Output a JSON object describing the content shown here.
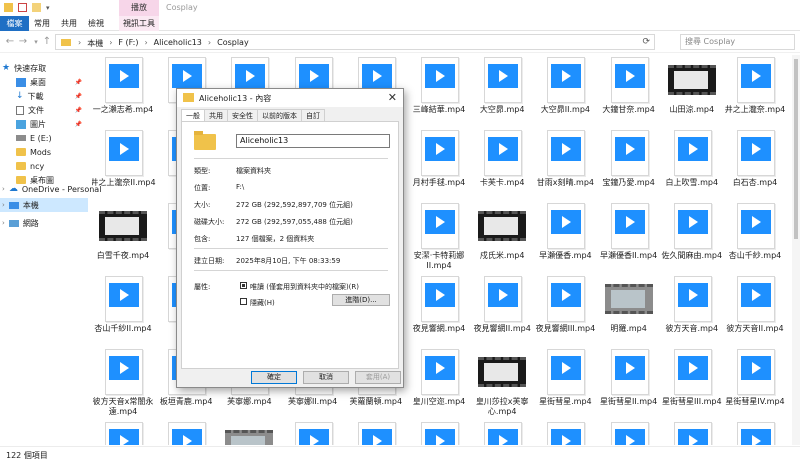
{
  "window": {
    "title": "Cosplay",
    "contextual_group": "播放"
  },
  "ribbon": {
    "file_tab": "檔案",
    "tabs": [
      "常用",
      "共用",
      "檢視",
      "視訊工具"
    ]
  },
  "nav": {
    "back": "←",
    "forward": "→",
    "up": "↑"
  },
  "address": {
    "crumbs": [
      "本機",
      "F (F:)",
      "Aliceholic13",
      "Cosplay"
    ]
  },
  "search": {
    "placeholder": "搜尋 Cosplay"
  },
  "sidebar": {
    "items": [
      {
        "label": "快速存取",
        "icon": "star-icon"
      },
      {
        "label": "桌面",
        "icon": "desktop-icon"
      },
      {
        "label": "下載",
        "icon": "download-icon"
      },
      {
        "label": "文件",
        "icon": "document-icon"
      },
      {
        "label": "圖片",
        "icon": "picture-icon"
      },
      {
        "label": "E (E:)",
        "icon": "drive-icon"
      },
      {
        "label": "Mods",
        "icon": "folder-icon"
      },
      {
        "label": "ncy",
        "icon": "folder-icon"
      },
      {
        "label": "桌布圖",
        "icon": "folder-icon"
      },
      {
        "label": "OneDrive - Personal",
        "icon": "cloud-icon"
      },
      {
        "label": "本機",
        "icon": "computer-icon"
      },
      {
        "label": "網路",
        "icon": "network-icon"
      }
    ]
  },
  "files": [
    "一之瀨志希.mp4",
    "八重",
    "",
    "",
    "",
    "三峰結華.mp4",
    "大空昴.mp4",
    "大空昴II.mp4",
    "大鐘甘奈.mp4",
    "山田涼.mp4",
    "井之上瀧奈.mp4",
    "井之上瀧奈II.mp4",
    "天",
    "",
    "",
    "",
    "月村手毬.mp4",
    "卡芙卡.mp4",
    "甘雨x刻晴.mp4",
    "宝鐘乃愛.mp4",
    "白上吹雪.mp4",
    "白石杏.mp4",
    "白雪千夜.mp4",
    "伊",
    "",
    "",
    "",
    "安潔·卡特莉娜II.mp4",
    "戍氏米.mp4",
    "早瀬優香.mp4",
    "早瀬優香II.mp4",
    "佐久間麻由.mp4",
    "杏山千紗.mp4",
    "杏山千紗II.mp4",
    "奈",
    "",
    "",
    "",
    "夜見響網.mp4",
    "夜見響網II.mp4",
    "夜見響網III.mp4",
    "明羅.mp4",
    "彼方天音.mp4",
    "彼方天音II.mp4",
    "彼方天音x常闇永遠.mp4",
    "板垣青鹿.mp4",
    "芙寧娜.mp4",
    "芙寧娜II.mp4",
    "芙蘿蘭頓.mp4",
    "皇川空迩.mp4",
    "皇川莎拉x芙寧心.mp4",
    "星街彗星.mp4",
    "星街彗星II.mp4",
    "星街彗星III.mp4",
    "星街彗星IV.mp4",
    "",
    "",
    "",
    "",
    "",
    "",
    "",
    "",
    "",
    "",
    ""
  ],
  "status": {
    "count": "122 個項目"
  },
  "dialog": {
    "title": "Aliceholic13 - 內容",
    "close": "✕",
    "tabs": [
      "一般",
      "共用",
      "安全性",
      "以前的版本",
      "自訂"
    ],
    "name_value": "Aliceholic13",
    "rows": {
      "type": {
        "k": "類型:",
        "v": "檔案資料夾"
      },
      "location": {
        "k": "位置:",
        "v": "F:\\"
      },
      "size": {
        "k": "大小:",
        "v": "272 GB (292,592,897,709 位元組)"
      },
      "size_on_disk": {
        "k": "磁碟大小:",
        "v": "272 GB (292,597,055,488 位元組)"
      },
      "contains": {
        "k": "包含:",
        "v": "127 個檔案，2 個資料夾"
      },
      "created": {
        "k": "建立日期:",
        "v": "2025年8月10日, 下午 08:33:59"
      },
      "attributes": {
        "k": "屬性:"
      }
    },
    "readonly_label": "唯讀 (僅套用到資料夾中的檔案)(R)",
    "hidden_label": "隱藏(H)",
    "advanced_btn": "進階(D)...",
    "ok_btn": "確定",
    "cancel_btn": "取消",
    "apply_btn": "套用(A)"
  }
}
